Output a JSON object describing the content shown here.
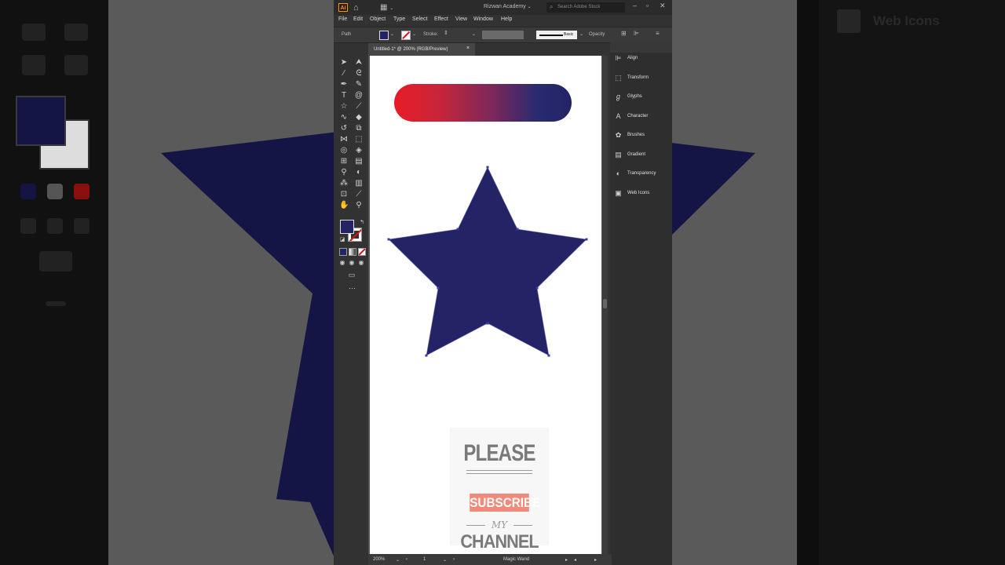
{
  "window": {
    "workspace_name": "Rizwan Academy",
    "search_placeholder": "Search Adobe Stock",
    "app_logo": "Ai"
  },
  "menu": [
    "File",
    "Edit",
    "Object",
    "Type",
    "Select",
    "Effect",
    "View",
    "Window",
    "Help"
  ],
  "control_bar": {
    "selection_label": "Path",
    "stroke_label": "Stroke:",
    "brush_label": "Basic",
    "opacity_label": "Opacity"
  },
  "document_tab": {
    "title": "Untitled-1* @ 200% (RGB/Preview)",
    "close_glyph": "×"
  },
  "panels": [
    {
      "label": "Align",
      "icon": "align-icon"
    },
    {
      "label": "Transform",
      "icon": "transform-icon"
    },
    {
      "label": "Glyphs",
      "icon": "glyphs-icon"
    },
    {
      "label": "Character",
      "icon": "character-icon"
    },
    {
      "label": "Brushes",
      "icon": "brushes-icon"
    },
    {
      "label": "Gradient",
      "icon": "gradient-icon"
    },
    {
      "label": "Transparency",
      "icon": "transparency-icon"
    },
    {
      "label": "Web Icons",
      "icon": "web-icons-icon"
    }
  ],
  "status_bar": {
    "zoom": "200%",
    "artboard_number": "1",
    "current_tool": "Magic Wand"
  },
  "overlay": {
    "please": "PLEASE",
    "subscribe": "SUBSCRIBE",
    "my": "MY",
    "channel": "CHANNEL"
  },
  "background_panel_label": "Web Icons",
  "colors": {
    "fill": "#232366",
    "gradient_start": "#e81c27",
    "gradient_end": "#232366",
    "stroke_none_slash": "#e01010"
  }
}
